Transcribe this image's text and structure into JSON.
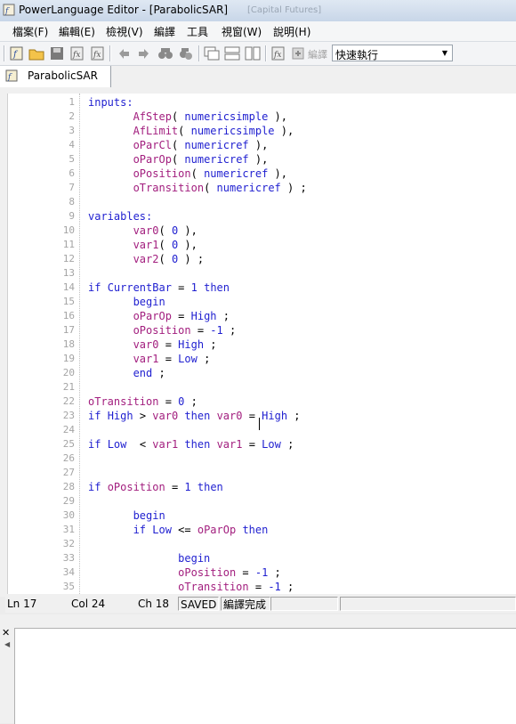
{
  "window": {
    "title": "PowerLanguage Editor - [ParabolicSAR]",
    "ghost_text": "[Capital Futures]"
  },
  "menu": [
    "檔案(F)",
    "編輯(E)",
    "檢視(V)",
    "編譯",
    "工具",
    "視窗(W)",
    "說明(H)"
  ],
  "toolbar": {
    "compile_label": "編譯",
    "mode_value": "快速執行"
  },
  "tab": {
    "label": "ParabolicSAR"
  },
  "status": {
    "ln": "Ln 17",
    "col": "Col 24",
    "ch": "Ch 18",
    "saved": "SAVED",
    "compile": "編譯完成"
  },
  "code_lines": [
    [
      {
        "t": "inputs:",
        "c": "kw"
      }
    ],
    [
      {
        "t": "       "
      },
      {
        "t": "AfStep",
        "c": "inp"
      },
      {
        "t": "( "
      },
      {
        "t": "numericsimple",
        "c": "typ"
      },
      {
        "t": " ),"
      }
    ],
    [
      {
        "t": "       "
      },
      {
        "t": "AfLimit",
        "c": "inp"
      },
      {
        "t": "( "
      },
      {
        "t": "numericsimple",
        "c": "typ"
      },
      {
        "t": " ),"
      }
    ],
    [
      {
        "t": "       "
      },
      {
        "t": "oParCl",
        "c": "inp"
      },
      {
        "t": "( "
      },
      {
        "t": "numericref",
        "c": "typ"
      },
      {
        "t": " ),"
      }
    ],
    [
      {
        "t": "       "
      },
      {
        "t": "oParOp",
        "c": "inp"
      },
      {
        "t": "( "
      },
      {
        "t": "numericref",
        "c": "typ"
      },
      {
        "t": " ),"
      }
    ],
    [
      {
        "t": "       "
      },
      {
        "t": "oPosition",
        "c": "inp"
      },
      {
        "t": "( "
      },
      {
        "t": "numericref",
        "c": "typ"
      },
      {
        "t": " ),"
      }
    ],
    [
      {
        "t": "       "
      },
      {
        "t": "oTransition",
        "c": "inp"
      },
      {
        "t": "( "
      },
      {
        "t": "numericref",
        "c": "typ"
      },
      {
        "t": " ) ;"
      }
    ],
    [],
    [
      {
        "t": "variables:",
        "c": "kw"
      }
    ],
    [
      {
        "t": "       "
      },
      {
        "t": "var0",
        "c": "var"
      },
      {
        "t": "( "
      },
      {
        "t": "0",
        "c": "num"
      },
      {
        "t": " ),"
      }
    ],
    [
      {
        "t": "       "
      },
      {
        "t": "var1",
        "c": "var"
      },
      {
        "t": "( "
      },
      {
        "t": "0",
        "c": "num"
      },
      {
        "t": " ),"
      }
    ],
    [
      {
        "t": "       "
      },
      {
        "t": "var2",
        "c": "var"
      },
      {
        "t": "( "
      },
      {
        "t": "0",
        "c": "num"
      },
      {
        "t": " ) ;"
      }
    ],
    [],
    [
      {
        "t": "if",
        "c": "kw"
      },
      {
        "t": " "
      },
      {
        "t": "CurrentBar",
        "c": "kw"
      },
      {
        "t": " = "
      },
      {
        "t": "1",
        "c": "num"
      },
      {
        "t": " "
      },
      {
        "t": "then",
        "c": "kw"
      }
    ],
    [
      {
        "t": "       "
      },
      {
        "t": "begin",
        "c": "kw"
      }
    ],
    [
      {
        "t": "       "
      },
      {
        "t": "oParOp",
        "c": "inp"
      },
      {
        "t": " = "
      },
      {
        "t": "High",
        "c": "kw"
      },
      {
        "t": " ;"
      }
    ],
    [
      {
        "t": "       "
      },
      {
        "t": "oPosition",
        "c": "inp"
      },
      {
        "t": " = "
      },
      {
        "t": "-1",
        "c": "num"
      },
      {
        "t": " ;"
      }
    ],
    [
      {
        "t": "       "
      },
      {
        "t": "var0",
        "c": "var"
      },
      {
        "t": " = "
      },
      {
        "t": "High",
        "c": "kw"
      },
      {
        "t": " ;"
      }
    ],
    [
      {
        "t": "       "
      },
      {
        "t": "var1",
        "c": "var"
      },
      {
        "t": " = "
      },
      {
        "t": "Low",
        "c": "kw"
      },
      {
        "t": " ;"
      }
    ],
    [
      {
        "t": "       "
      },
      {
        "t": "end",
        "c": "kw"
      },
      {
        "t": " ;"
      }
    ],
    [],
    [
      {
        "t": "oTransition",
        "c": "inp"
      },
      {
        "t": " = "
      },
      {
        "t": "0",
        "c": "num"
      },
      {
        "t": " ;"
      }
    ],
    [
      {
        "t": "if",
        "c": "kw"
      },
      {
        "t": " "
      },
      {
        "t": "High",
        "c": "kw"
      },
      {
        "t": " > "
      },
      {
        "t": "var0",
        "c": "var"
      },
      {
        "t": " "
      },
      {
        "t": "then",
        "c": "kw"
      },
      {
        "t": " "
      },
      {
        "t": "var0",
        "c": "var"
      },
      {
        "t": " = "
      },
      {
        "t": "High",
        "c": "kw"
      },
      {
        "t": " ;"
      }
    ],
    [],
    [
      {
        "t": "if",
        "c": "kw"
      },
      {
        "t": " "
      },
      {
        "t": "Low",
        "c": "kw"
      },
      {
        "t": "  < "
      },
      {
        "t": "var1",
        "c": "var"
      },
      {
        "t": " "
      },
      {
        "t": "then",
        "c": "kw"
      },
      {
        "t": " "
      },
      {
        "t": "var1",
        "c": "var"
      },
      {
        "t": " = "
      },
      {
        "t": "Low",
        "c": "kw"
      },
      {
        "t": " ;"
      }
    ],
    [],
    [],
    [
      {
        "t": "if",
        "c": "kw"
      },
      {
        "t": " "
      },
      {
        "t": "oPosition",
        "c": "inp"
      },
      {
        "t": " = "
      },
      {
        "t": "1",
        "c": "num"
      },
      {
        "t": " "
      },
      {
        "t": "then",
        "c": "kw"
      }
    ],
    [],
    [
      {
        "t": "       "
      },
      {
        "t": "begin",
        "c": "kw"
      }
    ],
    [
      {
        "t": "       "
      },
      {
        "t": "if",
        "c": "kw"
      },
      {
        "t": " "
      },
      {
        "t": "Low",
        "c": "kw"
      },
      {
        "t": " <= "
      },
      {
        "t": "oParOp",
        "c": "inp"
      },
      {
        "t": " "
      },
      {
        "t": "then",
        "c": "kw"
      }
    ],
    [],
    [
      {
        "t": "              "
      },
      {
        "t": "begin",
        "c": "kw"
      }
    ],
    [
      {
        "t": "              "
      },
      {
        "t": "oPosition",
        "c": "inp"
      },
      {
        "t": " = "
      },
      {
        "t": "-1",
        "c": "num"
      },
      {
        "t": " ;"
      }
    ],
    [
      {
        "t": "              "
      },
      {
        "t": "oTransition",
        "c": "inp"
      },
      {
        "t": " = "
      },
      {
        "t": "-1",
        "c": "num"
      },
      {
        "t": " ;"
      }
    ]
  ]
}
